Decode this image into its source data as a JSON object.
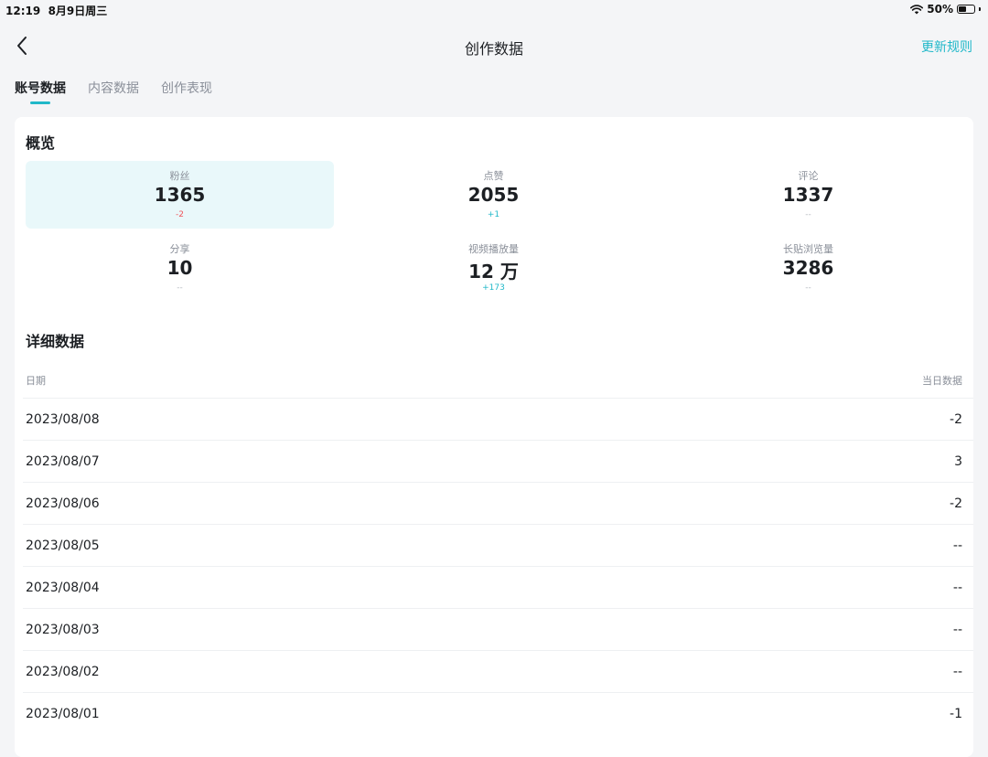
{
  "status_bar": {
    "time": "12:19",
    "date": "8月9日周三",
    "battery_percent": "50%",
    "battery_level": 0.5
  },
  "nav": {
    "title": "创作数据",
    "action": "更新规则"
  },
  "tabs": [
    {
      "label": "账号数据",
      "active": true
    },
    {
      "label": "内容数据",
      "active": false
    },
    {
      "label": "创作表现",
      "active": false
    }
  ],
  "overview": {
    "title": "概览",
    "stats": [
      {
        "label": "粉丝",
        "value": "1365",
        "delta": "-2"
      },
      {
        "label": "点赞",
        "value": "2055",
        "delta": "+1"
      },
      {
        "label": "评论",
        "value": "1337",
        "delta": "--"
      },
      {
        "label": "分享",
        "value": "10",
        "delta": "--"
      },
      {
        "label": "视频播放量",
        "value": "12 万",
        "delta": "+173"
      },
      {
        "label": "长贴浏览量",
        "value": "3286",
        "delta": "--"
      }
    ]
  },
  "detail": {
    "title": "详细数据",
    "col_date": "日期",
    "col_value": "当日数据",
    "rows": [
      {
        "date": "2023/08/08",
        "value": "-2"
      },
      {
        "date": "2023/08/07",
        "value": "3"
      },
      {
        "date": "2023/08/06",
        "value": "-2"
      },
      {
        "date": "2023/08/05",
        "value": "--"
      },
      {
        "date": "2023/08/04",
        "value": "--"
      },
      {
        "date": "2023/08/03",
        "value": "--"
      },
      {
        "date": "2023/08/02",
        "value": "--"
      },
      {
        "date": "2023/08/01",
        "value": "-1"
      }
    ]
  },
  "colors": {
    "accent": "#21b8c9",
    "negative": "#f0545b",
    "highlight": "#e9f8fa"
  }
}
